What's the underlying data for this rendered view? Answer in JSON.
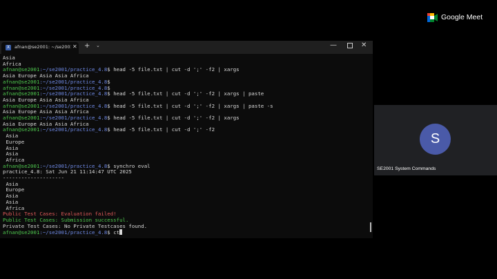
{
  "terminal": {
    "tab_title": "afnan@se2001: ~/se2001/prac",
    "tab_icon_glyph": "X",
    "tab_close_glyph": "✕",
    "new_tab_glyph": "+",
    "dropdown_glyph": "⌄",
    "minimize_glyph": "—",
    "close_glyph": "✕",
    "prompt_user": "afnan@se2001",
    "prompt_path": ":~/se2001/practice_4.8",
    "prompt_symbol": "$",
    "lines": [
      {
        "kind": "out",
        "text": "Asia"
      },
      {
        "kind": "out",
        "text": "Africa"
      },
      {
        "kind": "cmd",
        "text": " head -5 file.txt | cut -d ';' -f2 | xargs"
      },
      {
        "kind": "out",
        "text": "Asia Europe Asia Asia Africa"
      },
      {
        "kind": "cmd",
        "text": ""
      },
      {
        "kind": "cmd",
        "text": ""
      },
      {
        "kind": "cmd",
        "text": " head -5 file.txt | cut -d ';' -f2 | xargs | paste"
      },
      {
        "kind": "out",
        "text": "Asia Europe Asia Asia Africa"
      },
      {
        "kind": "cmd",
        "text": " head -5 file.txt | cut -d ';' -f2 | xargs | paste -s"
      },
      {
        "kind": "out",
        "text": "Asia Europe Asia Asia Africa"
      },
      {
        "kind": "cmd",
        "text": " head -5 file.txt | cut -d ';' -f2 | xargs"
      },
      {
        "kind": "out",
        "text": "Asia Europe Asia Asia Africa"
      },
      {
        "kind": "cmd",
        "text": " head -5 file.txt | cut -d ';' -f2"
      },
      {
        "kind": "out",
        "text": " Asia"
      },
      {
        "kind": "out",
        "text": " Europe"
      },
      {
        "kind": "out",
        "text": " Asia"
      },
      {
        "kind": "out",
        "text": " Asia"
      },
      {
        "kind": "out",
        "text": " Africa"
      },
      {
        "kind": "cmd",
        "text": " synchro eval"
      },
      {
        "kind": "out",
        "text": "practice_4.8: Sat Jun 21 11:14:47 UTC 2025"
      },
      {
        "kind": "out",
        "text": "--------------------"
      },
      {
        "kind": "out",
        "text": " Asia"
      },
      {
        "kind": "out",
        "text": " Europe"
      },
      {
        "kind": "out",
        "text": " Asia"
      },
      {
        "kind": "out",
        "text": " Asia"
      },
      {
        "kind": "out",
        "text": " Africa"
      },
      {
        "kind": "red",
        "text": "Public Test Cases: Evaluation failed!"
      },
      {
        "kind": "green",
        "text": "Public Test Cases: Submission successful."
      },
      {
        "kind": "out",
        "text": "Private Test Cases: No Private Testcases found."
      },
      {
        "kind": "cmd",
        "text": " ct",
        "cursor": true
      }
    ]
  },
  "meet": {
    "brand": "Google Meet",
    "avatar_initial": "S",
    "participant_name": "SE2001 System Commands",
    "colors": {
      "green": "#00832d",
      "blue": "#0066da",
      "yellow": "#ffba00",
      "red": "#e94235"
    }
  }
}
